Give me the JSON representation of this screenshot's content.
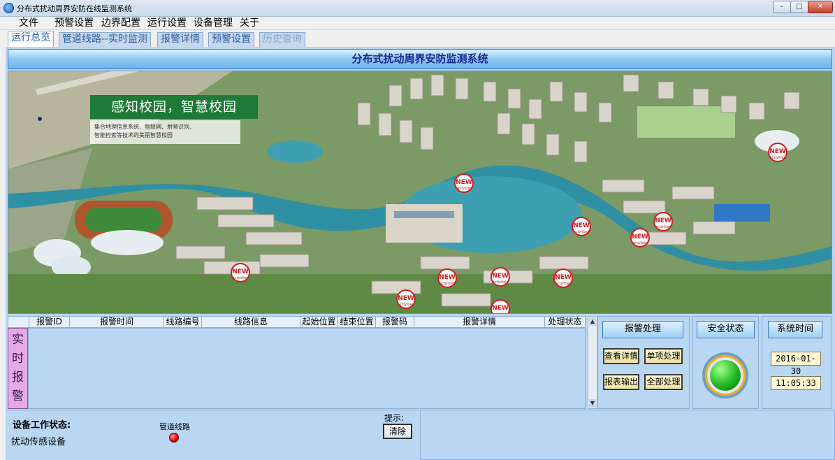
{
  "window": {
    "title": "分布式扰动周界安防在线监测系统"
  },
  "menu": [
    "文件",
    "预警设置",
    "边界配置",
    "运行设置",
    "设备管理",
    "关于"
  ],
  "tabs": [
    {
      "label": "运行总览"
    },
    {
      "label": "管道线路--实时监测"
    },
    {
      "label": "报警详情"
    },
    {
      "label": "预警设置"
    },
    {
      "label": "历史查询"
    }
  ],
  "header": {
    "title": "分布式扰动周界安防监测系统"
  },
  "map": {
    "banner_title": "感知校园，智慧校园",
    "banner_subtitle_1": "集合地理信息系统、物联网、射频识别、",
    "banner_subtitle_2": "智能检索等技术的美丽智慧校园",
    "badge_label": "NEW",
    "badge_sub": "activities"
  },
  "alarm_table": {
    "side_label": [
      "实",
      "时",
      "报",
      "警"
    ],
    "columns": [
      "报警ID",
      "报警时间",
      "线路编号",
      "线路信息",
      "起始位置",
      "结束位置",
      "报警码",
      "报警详情",
      "处理状态"
    ],
    "rows": []
  },
  "alarm_handling": {
    "title": "报警处理",
    "view_detail": "查看详情",
    "single_process": "单项处理",
    "export_report": "报表输出",
    "process_all": "全部处理"
  },
  "safety": {
    "title": "安全状态",
    "status_color": "#1fb81f"
  },
  "system_time": {
    "title": "系统时间",
    "date": "2016-01-30",
    "time": "11:05:33"
  },
  "device_status": {
    "title": "设备工作状态:",
    "device": "扰动传感设备",
    "line_label": "管道线路",
    "line_status_color": "#e00000"
  },
  "tips": {
    "label": "提示:",
    "clear": "清除"
  }
}
